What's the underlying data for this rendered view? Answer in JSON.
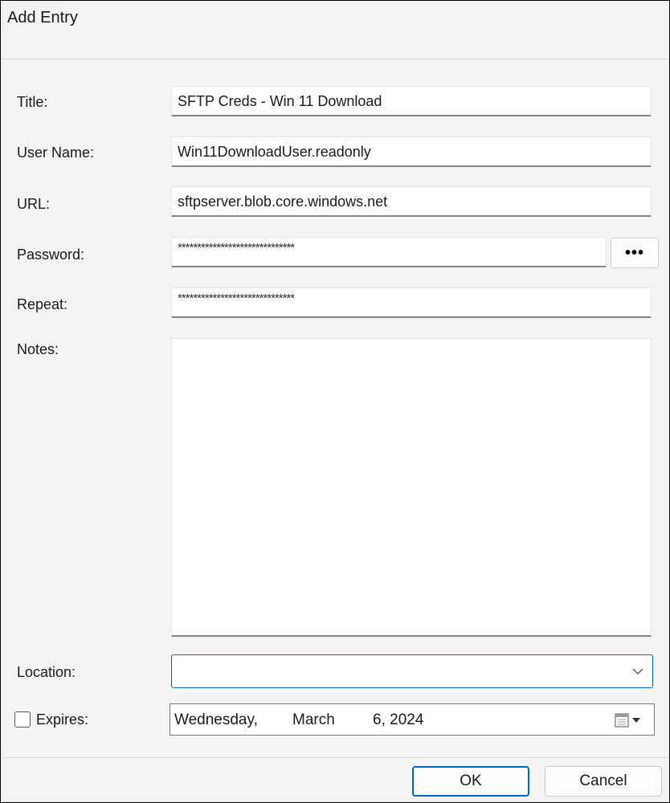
{
  "window": {
    "title": "Add Entry"
  },
  "fields": {
    "title": {
      "label": "Title:",
      "value": "SFTP Creds - Win 11 Download"
    },
    "username": {
      "label": "User Name:",
      "value": "Win11DownloadUser.readonly"
    },
    "url": {
      "label": "URL:",
      "value": "sftpserver.blob.core.windows.net"
    },
    "password": {
      "label": "Password:",
      "value": "******************************"
    },
    "repeat": {
      "label": "Repeat:",
      "value": "******************************"
    },
    "notes": {
      "label": "Notes:",
      "value": ""
    },
    "location": {
      "label": "Location:",
      "value": ""
    },
    "expires": {
      "label": "Expires:",
      "checked": false,
      "weekday": "Wednesday,",
      "month": "March",
      "day_year": "6, 2024"
    }
  },
  "password_reveal_button": {
    "label": "•••",
    "icon": "ellipsis-icon"
  },
  "buttons": {
    "ok": "OK",
    "cancel": "Cancel"
  },
  "colors": {
    "accent": "#0067c0",
    "background": "#f3f3f3"
  }
}
